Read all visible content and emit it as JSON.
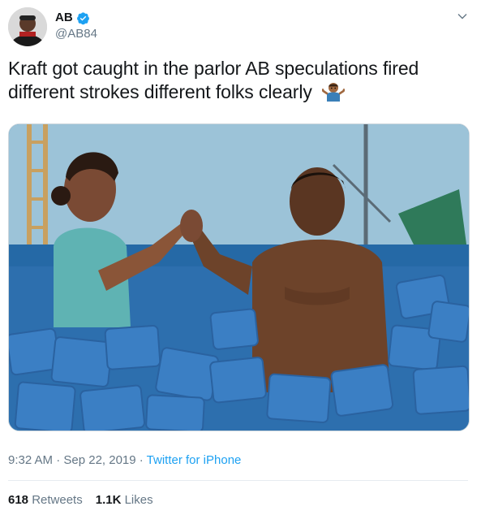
{
  "user": {
    "display_name": "AB",
    "handle": "@AB84",
    "verified": true
  },
  "tweet": {
    "text": "Kraft got caught in the parlor AB speculations fired different strokes different folks clearly",
    "emoji": "man-shrugging-emoji",
    "timestamp": "9:32 AM · Sep 22, 2019 · ",
    "source": "Twitter for iPhone"
  },
  "stats": {
    "retweets_count": "618",
    "retweets_label": " Retweets",
    "likes_count": "1.1K",
    "likes_label": " Likes"
  },
  "icons": {
    "verified": "verified-badge-icon",
    "caret": "chevron-down-icon"
  },
  "colors": {
    "accent": "#1da1f2",
    "secondary_text": "#657786",
    "primary_text": "#14171a"
  }
}
